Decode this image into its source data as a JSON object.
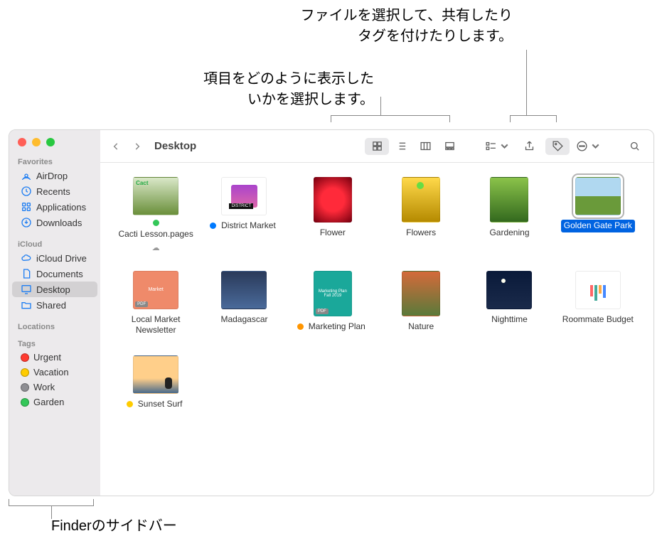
{
  "annotations": {
    "share_tag": "ファイルを選択して、共有したり\nタグを付けたりします。",
    "view_select": "項目をどのように表示した\nいかを選択します。",
    "finder_sidebar": "Finderのサイドバー"
  },
  "window": {
    "title": "Desktop"
  },
  "sidebar": {
    "sections": {
      "favorites": {
        "header": "Favorites",
        "items": [
          {
            "label": "AirDrop",
            "icon": "airdrop"
          },
          {
            "label": "Recents",
            "icon": "clock"
          },
          {
            "label": "Applications",
            "icon": "apps"
          },
          {
            "label": "Downloads",
            "icon": "download"
          }
        ]
      },
      "icloud": {
        "header": "iCloud",
        "items": [
          {
            "label": "iCloud Drive",
            "icon": "cloud"
          },
          {
            "label": "Documents",
            "icon": "doc"
          },
          {
            "label": "Desktop",
            "icon": "desktop",
            "selected": true
          },
          {
            "label": "Shared",
            "icon": "shared"
          }
        ]
      },
      "locations": {
        "header": "Locations"
      },
      "tags": {
        "header": "Tags",
        "items": [
          {
            "label": "Urgent",
            "color": "#ff3b30"
          },
          {
            "label": "Vacation",
            "color": "#ffcc00"
          },
          {
            "label": "Work",
            "color": "#8e8e93"
          },
          {
            "label": "Garden",
            "color": "#34c759"
          }
        ]
      }
    }
  },
  "toolbar": {
    "view_modes": [
      "icon",
      "list",
      "column",
      "gallery"
    ],
    "active_view": "icon"
  },
  "files": [
    {
      "label": "Cacti Lesson.pages",
      "tag": "#34c759",
      "icloud": true,
      "thumb": "cacti"
    },
    {
      "label": "District Market",
      "tag": "#007aff",
      "thumb": "market"
    },
    {
      "label": "Flower",
      "thumb": "flower",
      "portrait": true
    },
    {
      "label": "Flowers",
      "thumb": "flowers",
      "portrait": true
    },
    {
      "label": "Gardening",
      "thumb": "gardening",
      "portrait": true
    },
    {
      "label": "Golden Gate Park",
      "thumb": "ggpark",
      "selected": true
    },
    {
      "label": "Local Market Newsletter",
      "thumb": "newsletter"
    },
    {
      "label": "Madagascar",
      "thumb": "madagascar"
    },
    {
      "label": "Marketing Plan",
      "tag": "#ff9500",
      "thumb": "marketing",
      "portrait": true
    },
    {
      "label": "Nature",
      "thumb": "nature",
      "portrait": true
    },
    {
      "label": "Nighttime",
      "thumb": "night"
    },
    {
      "label": "Roommate Budget",
      "thumb": "budget"
    },
    {
      "label": "Sunset Surf",
      "tag": "#ffcc00",
      "thumb": "surf"
    }
  ]
}
